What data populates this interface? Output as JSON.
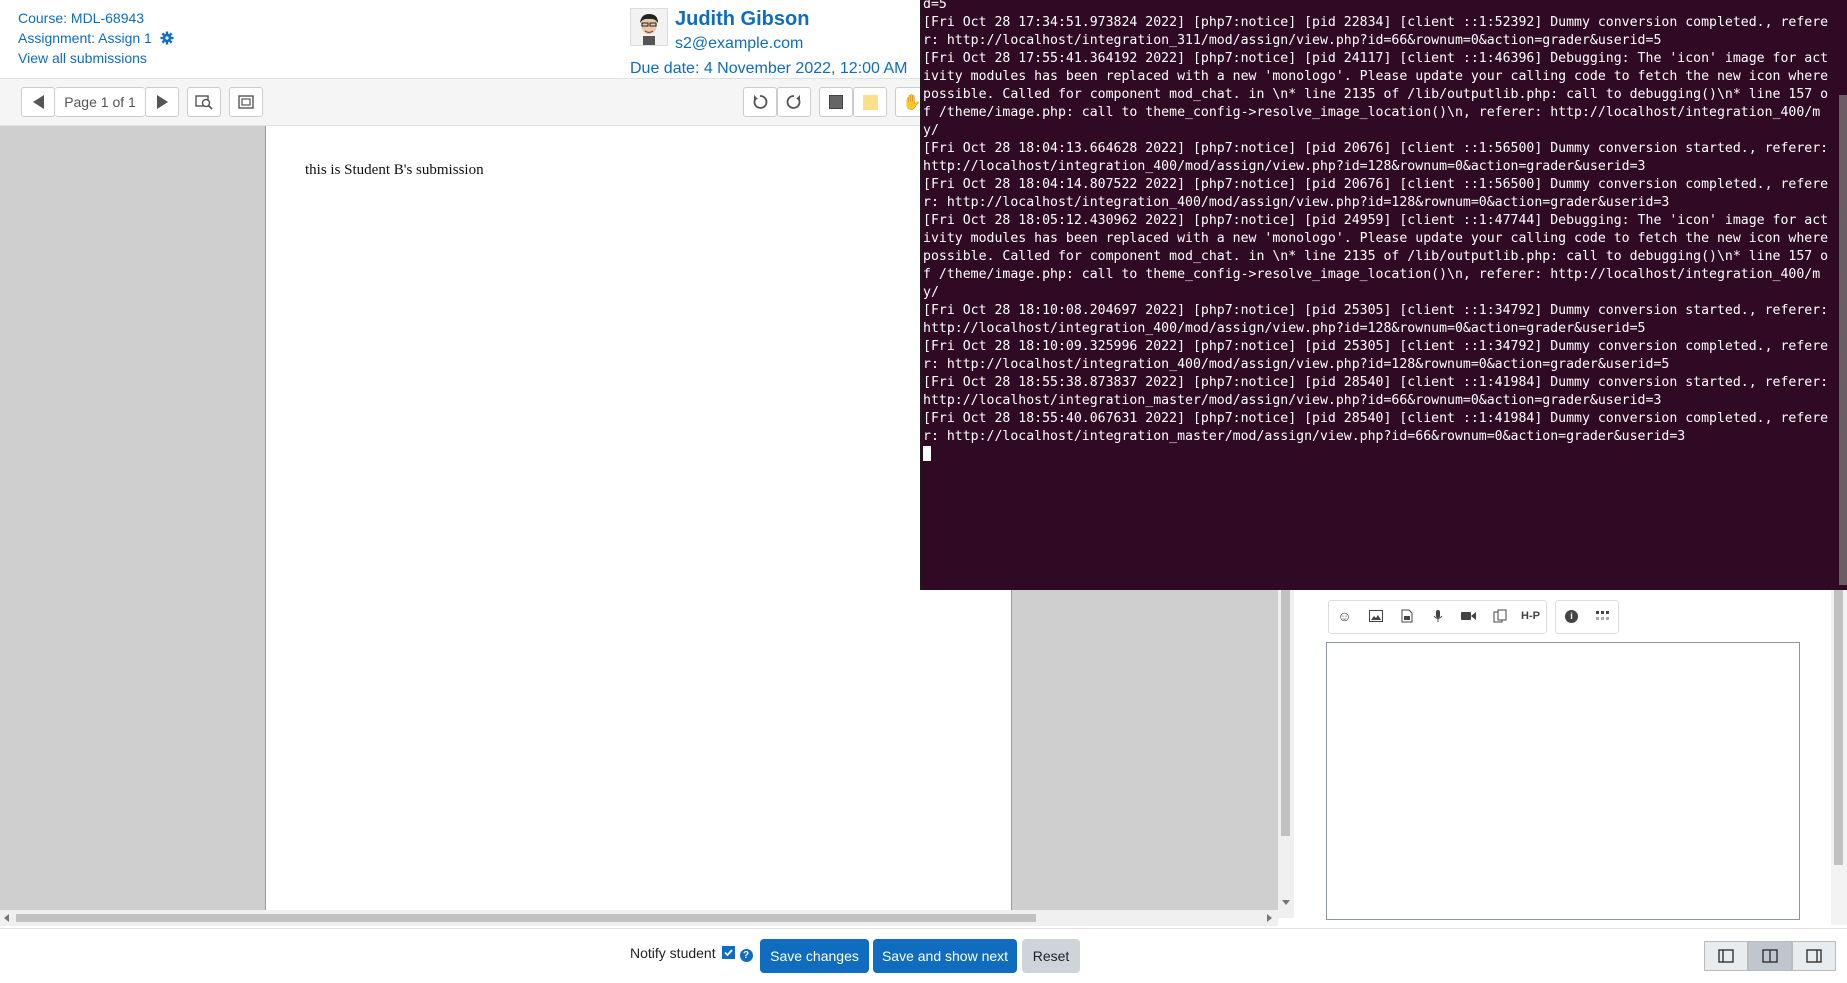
{
  "header": {
    "course_link": "Course: MDL-68943",
    "assignment_link": "Assignment: Assign 1",
    "view_all_link": "View all submissions",
    "user_name": "Judith Gibson",
    "user_email": "s2@example.com",
    "due_date": "Due date: 4 November 2022, 12:00 AM"
  },
  "toolbar": {
    "page_label": "Page 1 of 1"
  },
  "document": {
    "text": "this is Student B's submission"
  },
  "footer": {
    "notify_label": "Notify student",
    "help_glyph": "?",
    "save_changes": "Save changes",
    "save_and_show_next": "Save and show next",
    "reset": "Reset"
  },
  "editor_toolbar": {
    "h5p_label": "H-P"
  },
  "terminal": {
    "lines": [
      "d=5",
      "[Fri Oct 28 17:34:51.973824 2022] [php7:notice] [pid 22834] [client ::1:52392] Dummy conversion completed., referer: http://localhost/integration_311/mod/assign/view.php?id=66&rownum=0&action=grader&userid=5",
      "[Fri Oct 28 17:55:41.364192 2022] [php7:notice] [pid 24117] [client ::1:46396] Debugging: The 'icon' image for activity modules has been replaced with a new 'monologo'. Please update your calling code to fetch the new icon where possible. Called for component mod_chat. in \\n* line 2135 of /lib/outputlib.php: call to debugging()\\n* line 157 of /theme/image.php: call to theme_config->resolve_image_location()\\n, referer: http://localhost/integration_400/my/",
      "[Fri Oct 28 18:04:13.664628 2022] [php7:notice] [pid 20676] [client ::1:56500] Dummy conversion started., referer: http://localhost/integration_400/mod/assign/view.php?id=128&rownum=0&action=grader&userid=3",
      "[Fri Oct 28 18:04:14.807522 2022] [php7:notice] [pid 20676] [client ::1:56500] Dummy conversion completed., referer: http://localhost/integration_400/mod/assign/view.php?id=128&rownum=0&action=grader&userid=3",
      "[Fri Oct 28 18:05:12.430962 2022] [php7:notice] [pid 24959] [client ::1:47744] Debugging: The 'icon' image for activity modules has been replaced with a new 'monologo'. Please update your calling code to fetch the new icon where possible. Called for component mod_chat. in \\n* line 2135 of /lib/outputlib.php: call to debugging()\\n* line 157 of /theme/image.php: call to theme_config->resolve_image_location()\\n, referer: http://localhost/integration_400/my/",
      "[Fri Oct 28 18:10:08.204697 2022] [php7:notice] [pid 25305] [client ::1:34792] Dummy conversion started., referer: http://localhost/integration_400/mod/assign/view.php?id=128&rownum=0&action=grader&userid=5",
      "[Fri Oct 28 18:10:09.325996 2022] [php7:notice] [pid 25305] [client ::1:34792] Dummy conversion completed., referer: http://localhost/integration_400/mod/assign/view.php?id=128&rownum=0&action=grader&userid=5",
      "[Fri Oct 28 18:55:38.873837 2022] [php7:notice] [pid 28540] [client ::1:41984] Dummy conversion started., referer: http://localhost/integration_master/mod/assign/view.php?id=66&rownum=0&action=grader&userid=3",
      "[Fri Oct 28 18:55:40.067631 2022] [php7:notice] [pid 28540] [client ::1:41984] Dummy conversion completed., referer: http://localhost/integration_master/mod/assign/view.php?id=66&rownum=0&action=grader&userid=3"
    ]
  }
}
